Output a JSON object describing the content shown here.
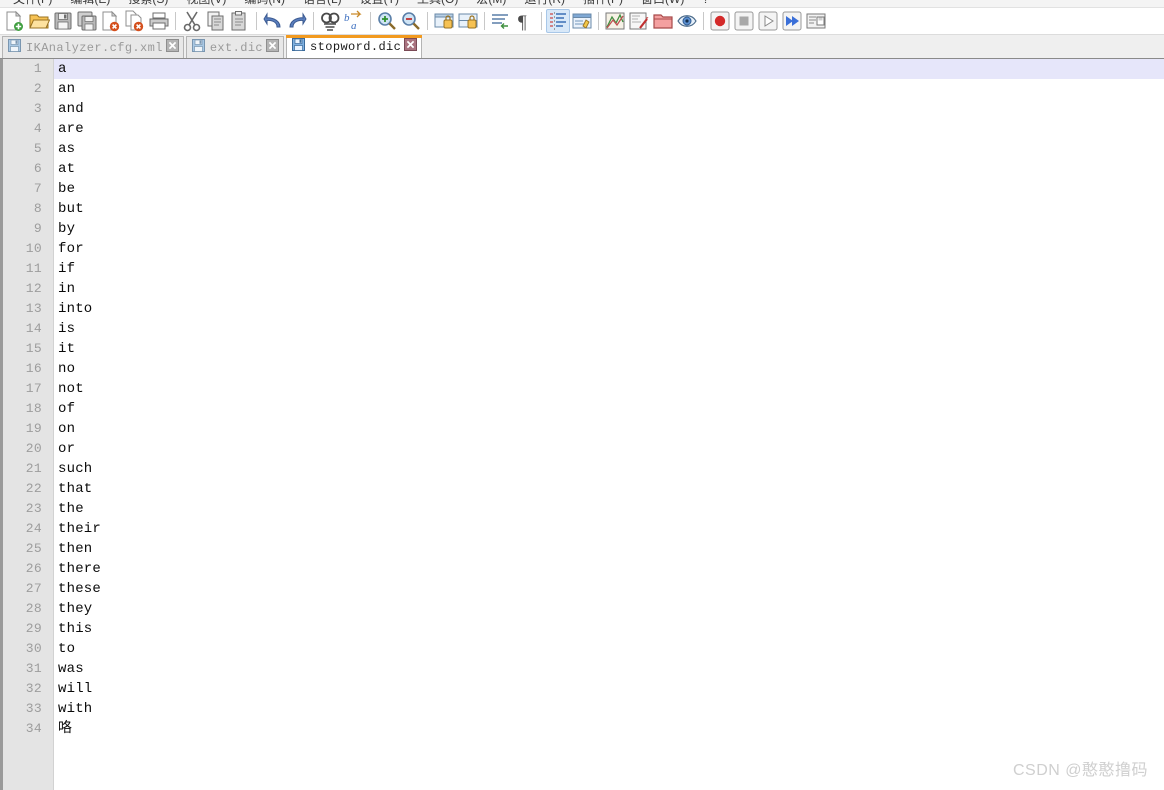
{
  "menu": {
    "items": [
      "文件(F)",
      "编辑(E)",
      "搜索(S)",
      "视图(V)",
      "编码(N)",
      "语言(L)",
      "设置(T)",
      "工具(O)",
      "宏(M)",
      "运行(R)",
      "插件(P)",
      "窗口(W)",
      "?"
    ]
  },
  "toolbar": {
    "groups": [
      [
        {
          "name": "new-file-icon",
          "title": "新建"
        },
        {
          "name": "open-file-icon",
          "title": "打开"
        },
        {
          "name": "save-icon",
          "title": "保存"
        },
        {
          "name": "save-all-icon",
          "title": "全部保存"
        },
        {
          "name": "close-file-icon",
          "title": "关闭"
        },
        {
          "name": "close-all-icon",
          "title": "全部关闭"
        },
        {
          "name": "print-icon",
          "title": "打印"
        }
      ],
      [
        {
          "name": "cut-icon",
          "title": "剪切"
        },
        {
          "name": "copy-icon",
          "title": "复制"
        },
        {
          "name": "paste-icon",
          "title": "粘贴"
        }
      ],
      [
        {
          "name": "undo-icon",
          "title": "撤销"
        },
        {
          "name": "redo-icon",
          "title": "重做"
        }
      ],
      [
        {
          "name": "find-icon",
          "title": "查找"
        },
        {
          "name": "replace-icon",
          "title": "替换"
        }
      ],
      [
        {
          "name": "zoom-in-icon",
          "title": "放大"
        },
        {
          "name": "zoom-out-icon",
          "title": "缩小"
        }
      ],
      [
        {
          "name": "sync-scroll-vertical-icon",
          "title": "同步垂直滚动"
        },
        {
          "name": "sync-scroll-horizontal-icon",
          "title": "同步水平滚动"
        }
      ],
      [
        {
          "name": "word-wrap-icon",
          "title": "自动换行"
        },
        {
          "name": "show-all-characters-icon",
          "title": "显示所有字符"
        }
      ],
      [
        {
          "name": "indent-guide-icon",
          "title": "显示缩进参考线",
          "active": true
        },
        {
          "name": "user-defined-dialog-icon",
          "title": "用户自定义对话框"
        }
      ],
      [
        {
          "name": "document-map-icon",
          "title": "文档列表"
        },
        {
          "name": "function-list-icon",
          "title": "函数列表"
        },
        {
          "name": "folder-as-workspace-icon",
          "title": "文件夹作为工作区"
        },
        {
          "name": "monitoring-icon",
          "title": "监视文件"
        }
      ],
      [
        {
          "name": "record-macro-icon",
          "title": "开始录制"
        },
        {
          "name": "stop-macro-icon",
          "title": "停止录制"
        },
        {
          "name": "play-macro-icon",
          "title": "播放"
        },
        {
          "name": "run-macro-multiple-icon",
          "title": "多次运行宏"
        },
        {
          "name": "save-macro-icon",
          "title": "保存当前录制的宏"
        }
      ]
    ]
  },
  "tabs": [
    {
      "label": "IKAnalyzer.cfg.xml",
      "active": false
    },
    {
      "label": "ext.dic",
      "active": false
    },
    {
      "label": "stopword.dic",
      "active": true
    }
  ],
  "editor": {
    "current_line": 1,
    "lines": [
      {
        "no": "1",
        "text": "a"
      },
      {
        "no": "2",
        "text": "an"
      },
      {
        "no": "3",
        "text": "and"
      },
      {
        "no": "4",
        "text": "are"
      },
      {
        "no": "5",
        "text": "as"
      },
      {
        "no": "6",
        "text": "at"
      },
      {
        "no": "7",
        "text": "be"
      },
      {
        "no": "8",
        "text": "but"
      },
      {
        "no": "9",
        "text": "by"
      },
      {
        "no": "10",
        "text": "for"
      },
      {
        "no": "11",
        "text": "if"
      },
      {
        "no": "12",
        "text": "in"
      },
      {
        "no": "13",
        "text": "into"
      },
      {
        "no": "14",
        "text": "is"
      },
      {
        "no": "15",
        "text": "it"
      },
      {
        "no": "16",
        "text": "no"
      },
      {
        "no": "17",
        "text": "not"
      },
      {
        "no": "18",
        "text": "of"
      },
      {
        "no": "19",
        "text": "on"
      },
      {
        "no": "20",
        "text": "or"
      },
      {
        "no": "21",
        "text": "such"
      },
      {
        "no": "22",
        "text": "that"
      },
      {
        "no": "23",
        "text": "the"
      },
      {
        "no": "24",
        "text": "their"
      },
      {
        "no": "25",
        "text": "then"
      },
      {
        "no": "26",
        "text": "there"
      },
      {
        "no": "27",
        "text": "these"
      },
      {
        "no": "28",
        "text": "they"
      },
      {
        "no": "29",
        "text": "this"
      },
      {
        "no": "30",
        "text": "to"
      },
      {
        "no": "31",
        "text": "was"
      },
      {
        "no": "32",
        "text": "will"
      },
      {
        "no": "33",
        "text": "with"
      },
      {
        "no": "34",
        "text": "咯"
      }
    ]
  },
  "watermark": {
    "text": "CSDN @憨憨撸码"
  },
  "colors": {
    "tab_active_accent": "#f29a1f",
    "current_line_highlight": "#e6e6fa",
    "gutter_bg": "#e4e4e4",
    "linenumber_fg": "#9d9d9d",
    "code_fg": "#0a0a0a",
    "watermark_fg": "#cfcfcf"
  }
}
